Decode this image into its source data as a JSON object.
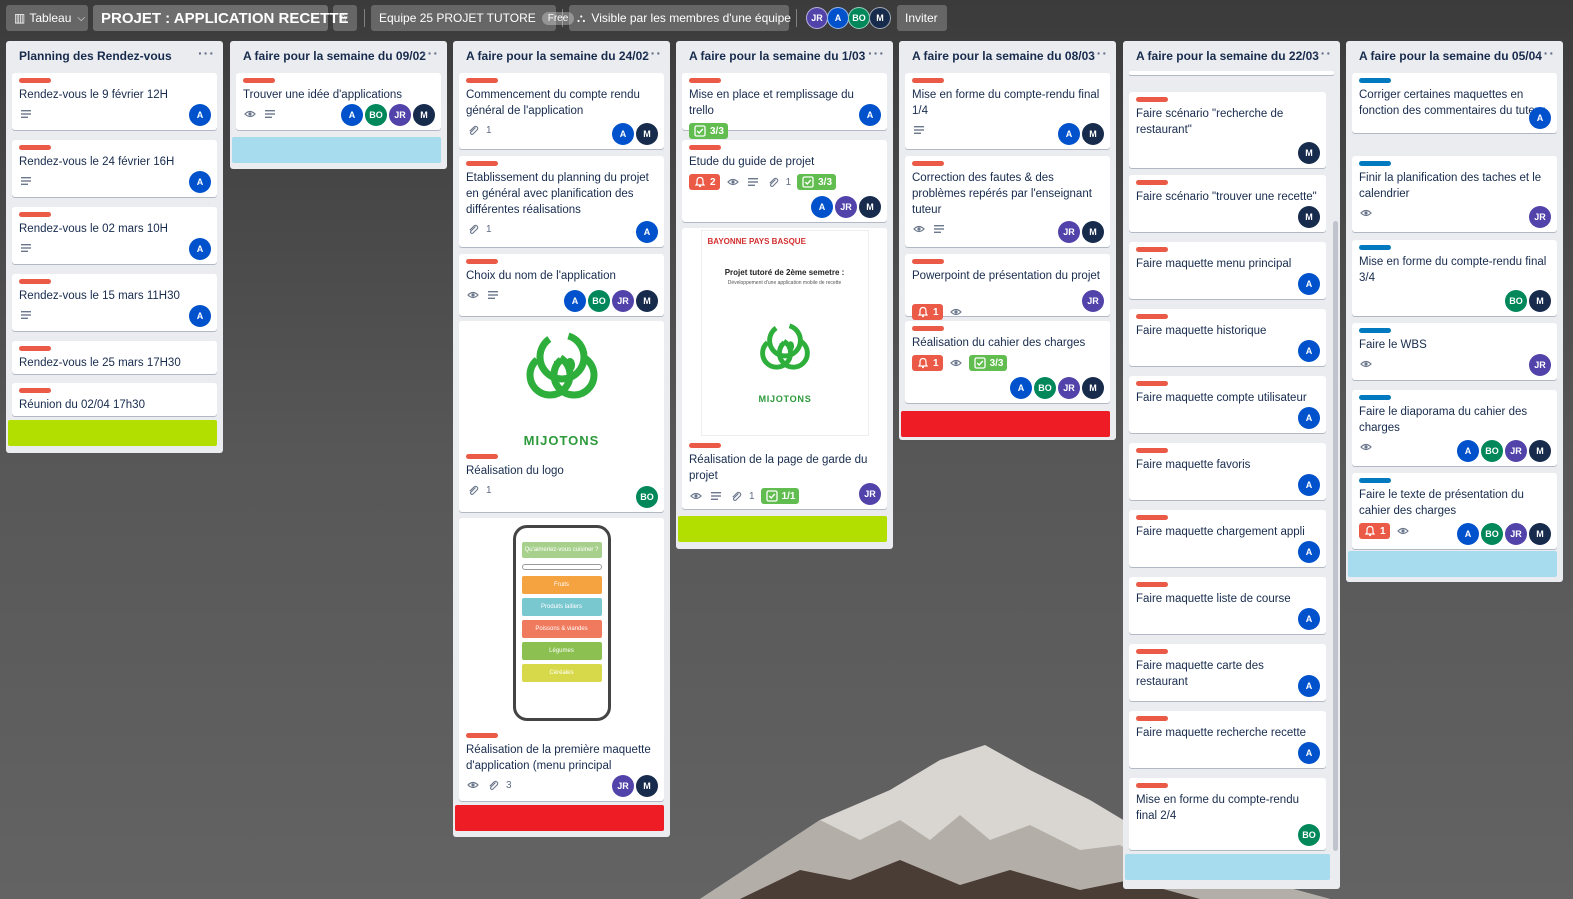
{
  "topbar": {
    "view_label": "Tableau",
    "board_title": "PROJET : APPLICATION RECETTE",
    "team_label": "Equipe 25 PROJET TUTORE",
    "team_plan": "Free",
    "visibility_label": "Visible par les membres d'une équipe",
    "members": [
      "JR",
      "A",
      "BO",
      "M"
    ],
    "invite_label": "Inviter"
  },
  "colors": {
    "label_red": "#eb5a46",
    "label_blue": "#0079bf",
    "avatar_A": "#0052cc",
    "avatar_BO": "#00875a",
    "avatar_JR": "#5243aa",
    "avatar_M": "#172b4d",
    "strip_green": "#b3df00",
    "strip_blue": "#a6dced",
    "strip_red": "#ee1c25"
  },
  "lists": [
    {
      "title": "Planning des Rendez-vous",
      "cards": [
        {
          "title": "Rendez-vous le 9 février 12H",
          "desc": true,
          "members": [
            "A"
          ]
        },
        {
          "title": "Rendez-vous le 24 février 16H",
          "desc": true,
          "members": [
            "A"
          ]
        },
        {
          "title": "Rendez-vous le 02 mars 10H",
          "desc": true,
          "members": [
            "A"
          ]
        },
        {
          "title": "Rendez-vous le 15 mars 11H30",
          "desc": true,
          "members": [
            "A"
          ]
        },
        {
          "title": "Rendez-vous le 25 mars 17H30",
          "members": []
        },
        {
          "title": "Réunion du 02/04 17h30",
          "members": []
        }
      ],
      "footer_color": "green"
    },
    {
      "title": "A faire pour la semaine du 09/02",
      "cards": [
        {
          "title": "Trouver une idée d'applications",
          "watch": true,
          "desc": true,
          "members": [
            "A",
            "BO",
            "JR",
            "M"
          ]
        }
      ],
      "footer_color": "blue"
    },
    {
      "title": "A faire pour la semaine du 24/02",
      "cards": [
        {
          "title": "Commencement du compte rendu général de l'application",
          "attachments": "1",
          "members": [
            "A",
            "M"
          ]
        },
        {
          "title": "Etablissement du planning du projet en général avec planification des différentes réalisations",
          "attachments": "1",
          "members": [
            "A"
          ]
        },
        {
          "title": "Choix du nom de l'application",
          "watch": true,
          "desc": true,
          "members": [
            "A",
            "BO",
            "JR",
            "M"
          ]
        },
        {
          "title": "Réalisation du logo",
          "attachments": "1",
          "members": [
            "BO"
          ],
          "cover": "MIJOTONS"
        },
        {
          "title": "Réalisation de la première maquette d'application (menu principal",
          "watch": true,
          "attachments": "3",
          "members": [
            "JR",
            "M"
          ],
          "cover_phone": {
            "header": "Qu'aimeriez-vous cuisiner ?",
            "rows": [
              "Fruits",
              "Produits laitiers",
              "Poissons & viandes",
              "Légumes",
              "Céréales"
            ]
          }
        }
      ],
      "footer_color": "red"
    },
    {
      "title": "A faire pour la semaine du 1/03",
      "cards": [
        {
          "title": "Mise en place et remplissage du trello",
          "checklist": "3/3",
          "members": [
            "A"
          ]
        },
        {
          "title": "Etude du guide de projet",
          "notifications": "2",
          "watch": true,
          "desc": true,
          "attachments": "1",
          "checklist": "3/3",
          "members": [
            "A",
            "JR",
            "M"
          ]
        },
        {
          "title": "Réalisation de la page de garde du projet",
          "watch": true,
          "desc": true,
          "attachments": "1",
          "checklist": "1/1",
          "members": [
            "JR"
          ],
          "cover_doc": {
            "org": "BAYONNE PAYS BASQUE",
            "heading": "Projet tutoré de 2ème semetre :",
            "sub": "Développement d'une application mobile de recette",
            "logo": "MIJOTONS"
          }
        }
      ],
      "footer_color": "green"
    },
    {
      "title": "A faire pour la semaine du 08/03",
      "cards": [
        {
          "title": "Mise en forme du compte-rendu final 1/4",
          "desc": true,
          "members": [
            "A",
            "M"
          ]
        },
        {
          "title": "Correction des fautes & des problèmes repérés par l'enseignant tuteur",
          "watch": true,
          "desc": true,
          "members": [
            "JR",
            "M"
          ]
        },
        {
          "title": "Powerpoint de présentation du projet",
          "notifications": "1",
          "watch": true,
          "members": [
            "JR"
          ]
        },
        {
          "title": "Réalisation du cahier des charges",
          "notifications": "1",
          "watch": true,
          "checklist": "3/3",
          "members": [
            "A",
            "BO",
            "JR",
            "M"
          ]
        }
      ],
      "footer_color": "red"
    },
    {
      "title": "A faire pour la semaine du 22/03",
      "cards": [
        {
          "title": "Faire scénario \"recherche de restaurant\"",
          "members": [
            "M"
          ]
        },
        {
          "title": "Faire scénario \"trouver une recette\"",
          "members": [
            "M"
          ]
        },
        {
          "title": "Faire maquette menu principal",
          "members": [
            "A"
          ]
        },
        {
          "title": "Faire maquette historique",
          "members": [
            "A"
          ]
        },
        {
          "title": "Faire maquette compte utilisateur",
          "members": [
            "A"
          ]
        },
        {
          "title": "Faire maquette favoris",
          "members": [
            "A"
          ]
        },
        {
          "title": "Faire maquette chargement appli",
          "members": [
            "A"
          ]
        },
        {
          "title": "Faire maquette liste de course",
          "members": [
            "A"
          ]
        },
        {
          "title": "Faire maquette carte des restaurant",
          "members": [
            "A"
          ]
        },
        {
          "title": "Faire maquette recherche recette",
          "members": [
            "A"
          ]
        },
        {
          "title": "Mise en forme du compte-rendu final 2/4",
          "members": [
            "BO"
          ]
        }
      ],
      "footer_color": "blue"
    },
    {
      "title": "A faire pour la semaine du 05/04",
      "cards": [
        {
          "title": "Corriger certaines maquettes en fonction des commentaires du tuteur",
          "members": [
            "A"
          ]
        },
        {
          "title": "Finir la planification des taches et le calendrier",
          "watch": true,
          "members": [
            "JR"
          ]
        },
        {
          "title": "Mise en forme du compte-rendu final 3/4",
          "members": [
            "BO",
            "M"
          ]
        },
        {
          "title": "Faire le WBS",
          "watch": true,
          "members": [
            "JR"
          ]
        },
        {
          "title": "Faire le diaporama du cahier des charges",
          "watch": true,
          "members": [
            "A",
            "BO",
            "JR",
            "M"
          ]
        },
        {
          "title": "Faire le texte de présentation du cahier des charges",
          "notifications": "1",
          "watch": true,
          "members": [
            "A",
            "BO",
            "JR",
            "M"
          ]
        }
      ],
      "footer_color": "blue"
    }
  ]
}
